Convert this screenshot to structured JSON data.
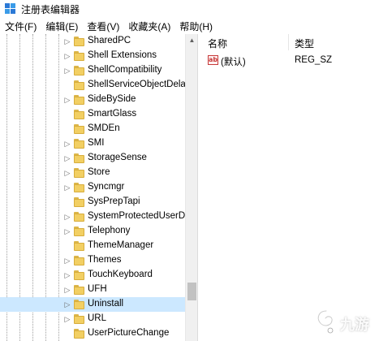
{
  "window": {
    "title": "注册表编辑器"
  },
  "menu": {
    "items": [
      "文件(F)",
      "编辑(E)",
      "查看(V)",
      "收藏夹(A)",
      "帮助(H)"
    ]
  },
  "tree": {
    "items": [
      {
        "label": "SharedPC",
        "selected": false
      },
      {
        "label": "Shell Extensions",
        "selected": false
      },
      {
        "label": "ShellCompatibility",
        "selected": false
      },
      {
        "label": "ShellServiceObjectDela",
        "selected": false
      },
      {
        "label": "SideBySide",
        "selected": false
      },
      {
        "label": "SmartGlass",
        "selected": false
      },
      {
        "label": "SMDEn",
        "selected": false
      },
      {
        "label": "SMI",
        "selected": false
      },
      {
        "label": "StorageSense",
        "selected": false
      },
      {
        "label": "Store",
        "selected": false
      },
      {
        "label": "Syncmgr",
        "selected": false
      },
      {
        "label": "SysPrepTapi",
        "selected": false
      },
      {
        "label": "SystemProtectedUserD",
        "selected": false
      },
      {
        "label": "Telephony",
        "selected": false
      },
      {
        "label": "ThemeManager",
        "selected": false
      },
      {
        "label": "Themes",
        "selected": false
      },
      {
        "label": "TouchKeyboard",
        "selected": false
      },
      {
        "label": "UFH",
        "selected": false
      },
      {
        "label": "Uninstall",
        "selected": true
      },
      {
        "label": "URL",
        "selected": false
      },
      {
        "label": "UserPictureChange",
        "selected": false
      }
    ]
  },
  "values": {
    "columns": {
      "name": "名称",
      "type": "类型"
    },
    "rows": [
      {
        "icon": "ab",
        "name": "(默认)",
        "type": "REG_SZ"
      }
    ]
  },
  "watermark": {
    "text": "九游"
  },
  "colors": {
    "folder": "#f2cf63",
    "selection": "#cce8ff",
    "string_icon": "#c73a3a"
  }
}
